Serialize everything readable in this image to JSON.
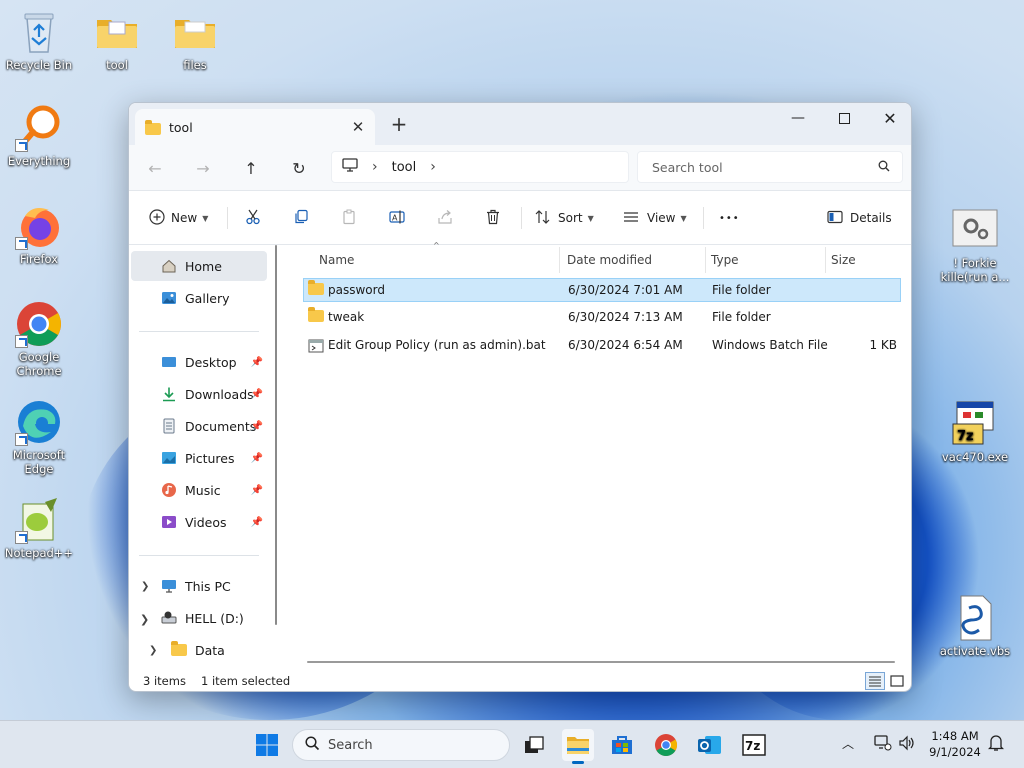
{
  "desktop": {
    "left_icons": [
      {
        "label": "Recycle Bin"
      },
      {
        "label": "tool"
      },
      {
        "label": "files"
      },
      {
        "label": "Everything"
      },
      {
        "label": "Firefox"
      },
      {
        "label": "Google\nChrome"
      },
      {
        "label": "Microsoft\nEdge"
      },
      {
        "label": "Notepad++"
      }
    ],
    "right_icons": [
      {
        "label": "! Forkie\nkille(run a..."
      },
      {
        "label": "vac470.exe"
      },
      {
        "label": "activate.vbs"
      }
    ]
  },
  "explorer": {
    "tab_title": "tool",
    "breadcrumb": {
      "location": "tool"
    },
    "search_placeholder": "Search tool",
    "toolbar": {
      "new_label": "New",
      "sort_label": "Sort",
      "view_label": "View",
      "more_label": "•••",
      "details_label": "Details"
    },
    "nav_pane": {
      "quick": [
        {
          "label": "Home",
          "selected": true
        },
        {
          "label": "Gallery"
        }
      ],
      "pinned": [
        {
          "label": "Desktop"
        },
        {
          "label": "Downloads"
        },
        {
          "label": "Documents"
        },
        {
          "label": "Pictures"
        },
        {
          "label": "Music"
        },
        {
          "label": "Videos"
        }
      ],
      "tree": [
        {
          "label": "This PC"
        },
        {
          "label": "HELL (D:)"
        },
        {
          "label": "Data"
        }
      ]
    },
    "columns": {
      "name": "Name",
      "date": "Date modified",
      "type": "Type",
      "size": "Size"
    },
    "files": [
      {
        "name": "password",
        "date": "6/30/2024 7:01 AM",
        "type": "File folder",
        "size": "",
        "selected": true
      },
      {
        "name": "tweak",
        "date": "6/30/2024 7:13 AM",
        "type": "File folder",
        "size": ""
      },
      {
        "name": "Edit Group Policy (run as admin).bat",
        "date": "6/30/2024 6:54 AM",
        "type": "Windows Batch File",
        "size": "1 KB"
      }
    ],
    "status": {
      "count": "3 items",
      "selection": "1 item selected"
    }
  },
  "taskbar": {
    "search_placeholder": "Search",
    "time": "1:48 AM",
    "date": "9/1/2024"
  },
  "colors": {
    "accent": "#0067c0",
    "selection": "#cde8fb",
    "folder": "#f8c84a"
  }
}
